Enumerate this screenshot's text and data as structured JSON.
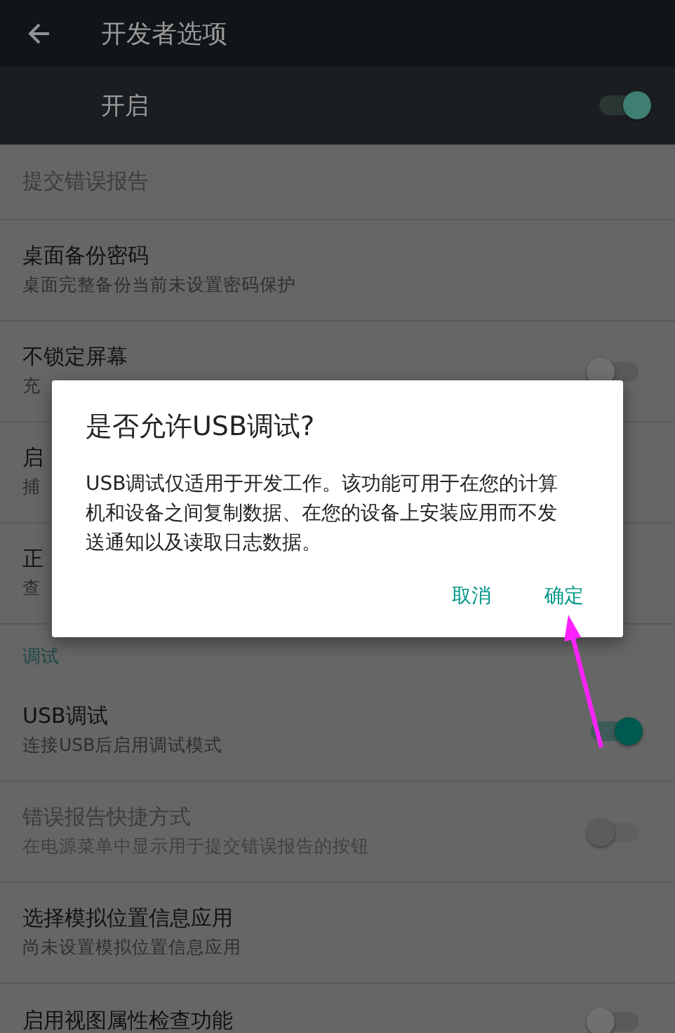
{
  "toolbar": {
    "title": "开发者选项"
  },
  "master_switch": {
    "label": "开启",
    "on": true
  },
  "settings": [
    {
      "kind": "plain",
      "title": "提交错误报告",
      "disabled": true
    },
    {
      "kind": "plain",
      "title": "桌面备份密码",
      "summary": "桌面完整备份当前未设置密码保护",
      "disabled": false
    },
    {
      "kind": "switch",
      "title": "不锁定屏幕",
      "summary": "充",
      "on": false,
      "disabled": false
    },
    {
      "kind": "plain",
      "title": "启",
      "summary": "捕",
      "disabled": false
    },
    {
      "kind": "plain",
      "title": "正",
      "summary": "查",
      "disabled": false
    },
    {
      "kind": "header",
      "title": "调试",
      "disabled": false
    },
    {
      "kind": "switch",
      "title": "USB调试",
      "summary": "连接USB后启用调试模式",
      "on": true,
      "disabled": false
    },
    {
      "kind": "switch",
      "title": "错误报告快捷方式",
      "summary": "在电源菜单中显示用于提交错误报告的按钮",
      "on": false,
      "disabled": true
    },
    {
      "kind": "plain",
      "title": "选择模拟位置信息应用",
      "summary": "尚未设置模拟位置信息应用",
      "disabled": false
    },
    {
      "kind": "switch",
      "title": "启用视图属性检查功能",
      "on": false,
      "disabled": false
    }
  ],
  "dialog": {
    "title": "是否允许USB调试?",
    "message": "USB调试仅适用于开发工作。该功能可用于在您的计算机和设备之间复制数据、在您的设备上安装应用而不发送通知以及读取日志数据。",
    "buttons": [
      {
        "label": "取消"
      },
      {
        "label": "确定"
      }
    ]
  }
}
